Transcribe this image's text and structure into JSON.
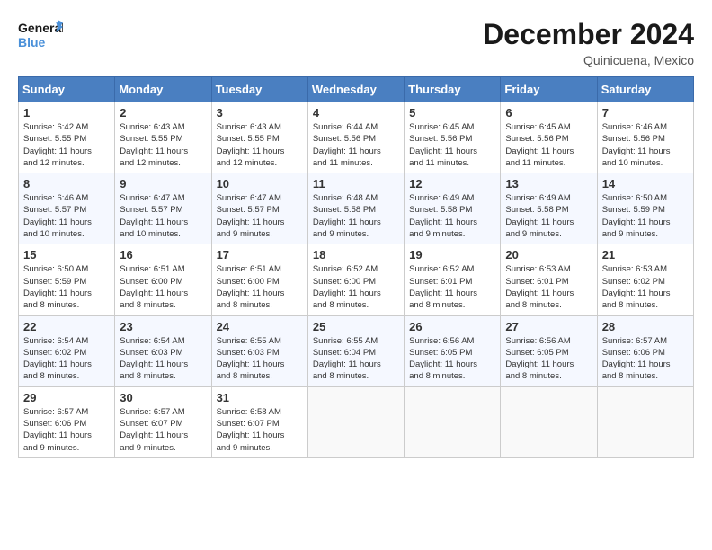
{
  "header": {
    "logo": {
      "line1": "General",
      "line2": "Blue"
    },
    "title": "December 2024",
    "subtitle": "Quinicuena, Mexico"
  },
  "weekdays": [
    "Sunday",
    "Monday",
    "Tuesday",
    "Wednesday",
    "Thursday",
    "Friday",
    "Saturday"
  ],
  "weeks": [
    [
      {
        "day": "1",
        "info": "Sunrise: 6:42 AM\nSunset: 5:55 PM\nDaylight: 11 hours\nand 12 minutes."
      },
      {
        "day": "2",
        "info": "Sunrise: 6:43 AM\nSunset: 5:55 PM\nDaylight: 11 hours\nand 12 minutes."
      },
      {
        "day": "3",
        "info": "Sunrise: 6:43 AM\nSunset: 5:55 PM\nDaylight: 11 hours\nand 12 minutes."
      },
      {
        "day": "4",
        "info": "Sunrise: 6:44 AM\nSunset: 5:56 PM\nDaylight: 11 hours\nand 11 minutes."
      },
      {
        "day": "5",
        "info": "Sunrise: 6:45 AM\nSunset: 5:56 PM\nDaylight: 11 hours\nand 11 minutes."
      },
      {
        "day": "6",
        "info": "Sunrise: 6:45 AM\nSunset: 5:56 PM\nDaylight: 11 hours\nand 11 minutes."
      },
      {
        "day": "7",
        "info": "Sunrise: 6:46 AM\nSunset: 5:56 PM\nDaylight: 11 hours\nand 10 minutes."
      }
    ],
    [
      {
        "day": "8",
        "info": "Sunrise: 6:46 AM\nSunset: 5:57 PM\nDaylight: 11 hours\nand 10 minutes."
      },
      {
        "day": "9",
        "info": "Sunrise: 6:47 AM\nSunset: 5:57 PM\nDaylight: 11 hours\nand 10 minutes."
      },
      {
        "day": "10",
        "info": "Sunrise: 6:47 AM\nSunset: 5:57 PM\nDaylight: 11 hours\nand 9 minutes."
      },
      {
        "day": "11",
        "info": "Sunrise: 6:48 AM\nSunset: 5:58 PM\nDaylight: 11 hours\nand 9 minutes."
      },
      {
        "day": "12",
        "info": "Sunrise: 6:49 AM\nSunset: 5:58 PM\nDaylight: 11 hours\nand 9 minutes."
      },
      {
        "day": "13",
        "info": "Sunrise: 6:49 AM\nSunset: 5:58 PM\nDaylight: 11 hours\nand 9 minutes."
      },
      {
        "day": "14",
        "info": "Sunrise: 6:50 AM\nSunset: 5:59 PM\nDaylight: 11 hours\nand 9 minutes."
      }
    ],
    [
      {
        "day": "15",
        "info": "Sunrise: 6:50 AM\nSunset: 5:59 PM\nDaylight: 11 hours\nand 8 minutes."
      },
      {
        "day": "16",
        "info": "Sunrise: 6:51 AM\nSunset: 6:00 PM\nDaylight: 11 hours\nand 8 minutes."
      },
      {
        "day": "17",
        "info": "Sunrise: 6:51 AM\nSunset: 6:00 PM\nDaylight: 11 hours\nand 8 minutes."
      },
      {
        "day": "18",
        "info": "Sunrise: 6:52 AM\nSunset: 6:00 PM\nDaylight: 11 hours\nand 8 minutes."
      },
      {
        "day": "19",
        "info": "Sunrise: 6:52 AM\nSunset: 6:01 PM\nDaylight: 11 hours\nand 8 minutes."
      },
      {
        "day": "20",
        "info": "Sunrise: 6:53 AM\nSunset: 6:01 PM\nDaylight: 11 hours\nand 8 minutes."
      },
      {
        "day": "21",
        "info": "Sunrise: 6:53 AM\nSunset: 6:02 PM\nDaylight: 11 hours\nand 8 minutes."
      }
    ],
    [
      {
        "day": "22",
        "info": "Sunrise: 6:54 AM\nSunset: 6:02 PM\nDaylight: 11 hours\nand 8 minutes."
      },
      {
        "day": "23",
        "info": "Sunrise: 6:54 AM\nSunset: 6:03 PM\nDaylight: 11 hours\nand 8 minutes."
      },
      {
        "day": "24",
        "info": "Sunrise: 6:55 AM\nSunset: 6:03 PM\nDaylight: 11 hours\nand 8 minutes."
      },
      {
        "day": "25",
        "info": "Sunrise: 6:55 AM\nSunset: 6:04 PM\nDaylight: 11 hours\nand 8 minutes."
      },
      {
        "day": "26",
        "info": "Sunrise: 6:56 AM\nSunset: 6:05 PM\nDaylight: 11 hours\nand 8 minutes."
      },
      {
        "day": "27",
        "info": "Sunrise: 6:56 AM\nSunset: 6:05 PM\nDaylight: 11 hours\nand 8 minutes."
      },
      {
        "day": "28",
        "info": "Sunrise: 6:57 AM\nSunset: 6:06 PM\nDaylight: 11 hours\nand 8 minutes."
      }
    ],
    [
      {
        "day": "29",
        "info": "Sunrise: 6:57 AM\nSunset: 6:06 PM\nDaylight: 11 hours\nand 9 minutes."
      },
      {
        "day": "30",
        "info": "Sunrise: 6:57 AM\nSunset: 6:07 PM\nDaylight: 11 hours\nand 9 minutes."
      },
      {
        "day": "31",
        "info": "Sunrise: 6:58 AM\nSunset: 6:07 PM\nDaylight: 11 hours\nand 9 minutes."
      },
      null,
      null,
      null,
      null
    ]
  ]
}
